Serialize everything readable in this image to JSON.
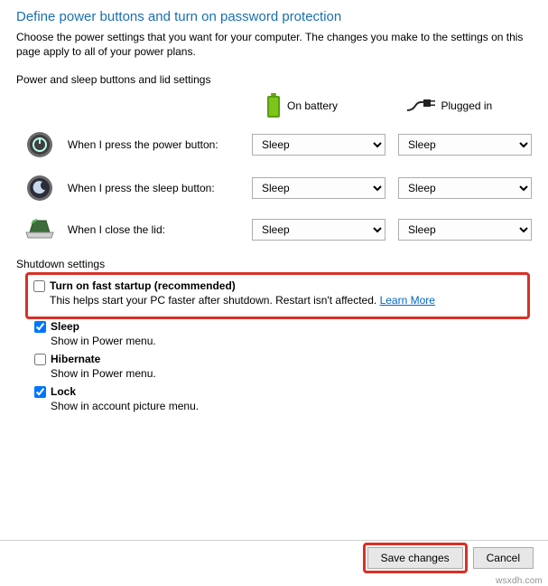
{
  "title": "Define power buttons and turn on password protection",
  "description": "Choose the power settings that you want for your computer. The changes you make to the settings on this page apply to all of your power plans.",
  "sections": {
    "power_sleep_heading": "Power and sleep buttons and lid settings",
    "columns": {
      "battery": "On battery",
      "plugged": "Plugged in"
    },
    "rows": {
      "power_button": {
        "label": "When I press the power button:",
        "battery_value": "Sleep",
        "plugged_value": "Sleep"
      },
      "sleep_button": {
        "label": "When I press the sleep button:",
        "battery_value": "Sleep",
        "plugged_value": "Sleep"
      },
      "lid": {
        "label": "When I close the lid:",
        "battery_value": "Sleep",
        "plugged_value": "Sleep"
      }
    }
  },
  "shutdown": {
    "heading": "Shutdown settings",
    "fast_startup": {
      "label": "Turn on fast startup (recommended)",
      "desc": "This helps start your PC faster after shutdown. Restart isn't affected. ",
      "link": "Learn More"
    },
    "sleep": {
      "label": "Sleep",
      "desc": "Show in Power menu."
    },
    "hibernate": {
      "label": "Hibernate",
      "desc": "Show in Power menu."
    },
    "lock": {
      "label": "Lock",
      "desc": "Show in account picture menu."
    }
  },
  "buttons": {
    "save": "Save changes",
    "cancel": "Cancel"
  },
  "watermark": "wsxdh.com"
}
